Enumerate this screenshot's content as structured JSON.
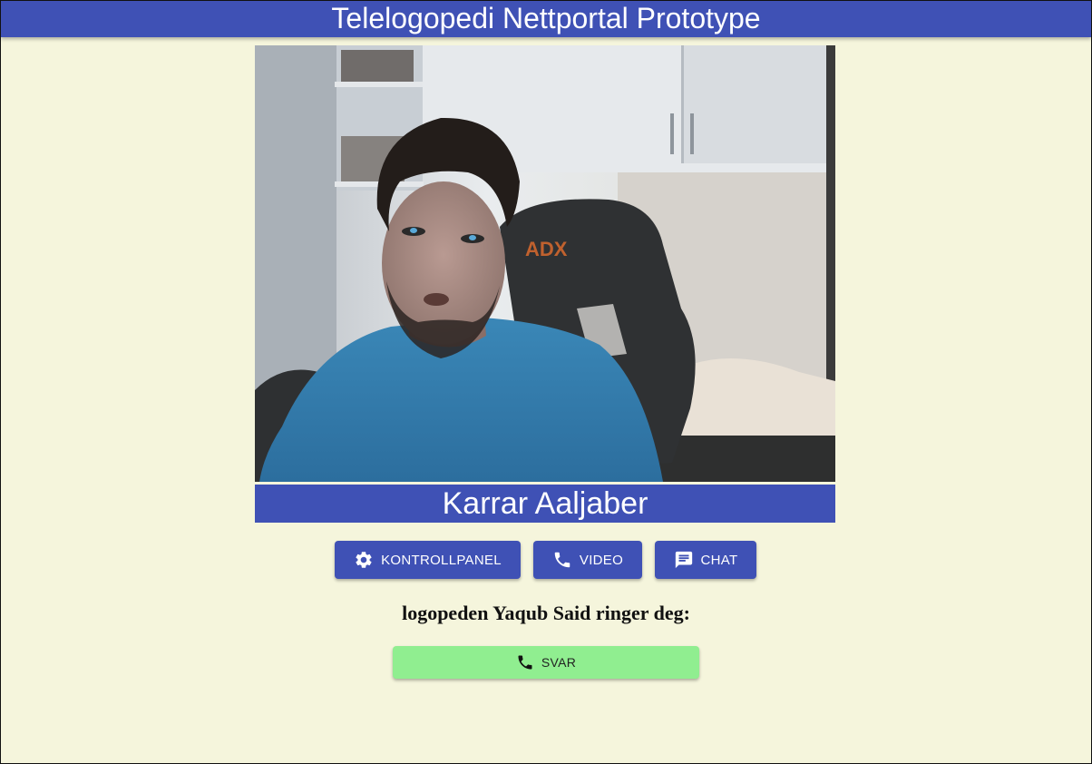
{
  "header": {
    "title": "Telelogopedi Nettportal Prototype"
  },
  "video": {
    "participant_name": "Karrar Aaljaber",
    "chair_brand": "ADX"
  },
  "toolbar": {
    "buttons": [
      {
        "label": "KONTROLLPANEL",
        "icon": "gear-icon"
      },
      {
        "label": "VIDEO",
        "icon": "phone-icon"
      },
      {
        "label": "CHAT",
        "icon": "chat-icon"
      }
    ]
  },
  "incoming_call": {
    "message": "logopeden Yaqub Said ringer deg:",
    "answer_label": "SVAR",
    "answer_icon": "phone-icon"
  },
  "colors": {
    "primary": "#3f51b5",
    "background": "#f5f5dc",
    "answer": "#90ee90"
  }
}
